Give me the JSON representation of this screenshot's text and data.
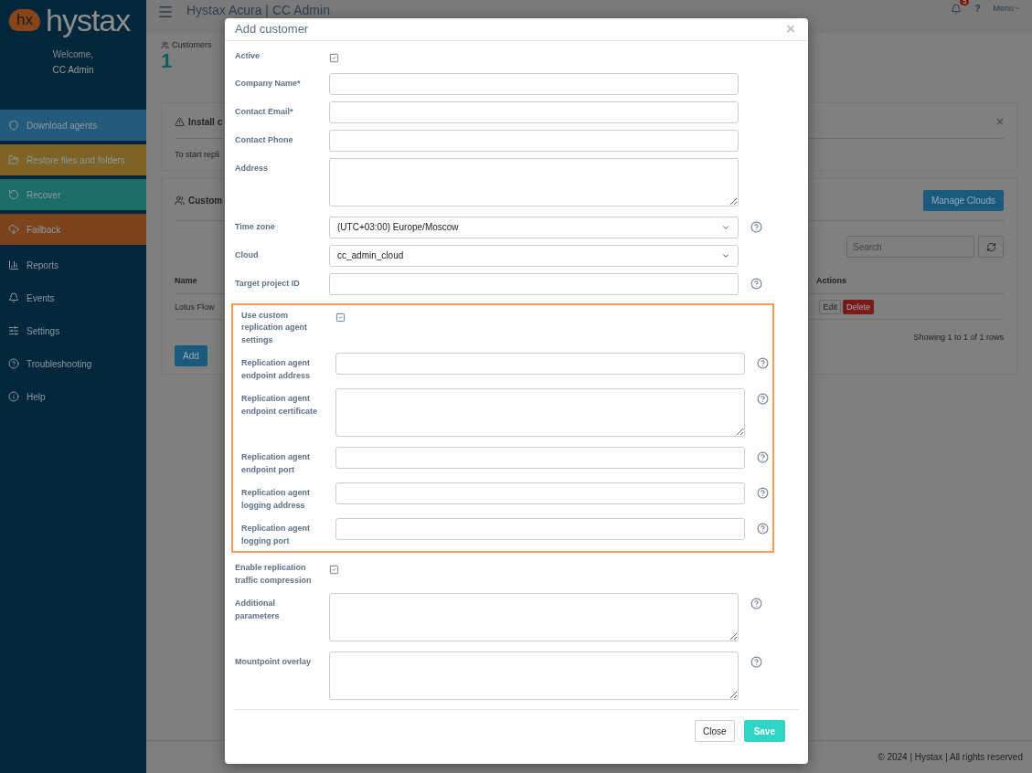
{
  "sidebar": {
    "logo": {
      "mark": "hx",
      "name": "hystax"
    },
    "welcome": "Welcome,",
    "user": "CC Admin",
    "items": [
      {
        "label": "Download agents",
        "color": "#255a7b"
      },
      {
        "label": "Restore files and folders",
        "color": "#7e6226"
      },
      {
        "label": "Recover",
        "color": "#1b6d65"
      },
      {
        "label": "Failback",
        "color": "#7c441d"
      },
      {
        "label": "Reports"
      },
      {
        "label": "Events"
      },
      {
        "label": "Settings"
      },
      {
        "label": "Troubleshooting"
      },
      {
        "label": "Help"
      }
    ]
  },
  "header": {
    "title": "Hystax Acura | CC Admin",
    "notifications": "5",
    "help": "?",
    "menu": "Menu"
  },
  "stats": {
    "label": "Customers",
    "value": "1"
  },
  "install_panel": {
    "title": "Install c",
    "text": "To start repli",
    "close": "×"
  },
  "customers_panel": {
    "title": "Custom",
    "manage_button": "Manage Clouds",
    "search": {
      "placeholder": "Search"
    },
    "columns": [
      "Name",
      "Actions"
    ],
    "rows": [
      {
        "name": "Lotus Flow",
        "actions": [
          "Edit",
          "Delete"
        ]
      }
    ],
    "pagination": "Showing 1 to 1 of 1 rows",
    "add_button": "Add"
  },
  "footer": "© 2024 | Hystax | All rights reserved",
  "modal": {
    "title": "Add customer",
    "close": "×",
    "fields": [
      {
        "kind": "checkbox",
        "label": "Active",
        "checked": true,
        "help": false
      },
      {
        "kind": "input",
        "label": "Company Name*",
        "help": false
      },
      {
        "kind": "input",
        "label": "Contact Email*",
        "help": false
      },
      {
        "kind": "input",
        "label": "Contact Phone",
        "help": false
      },
      {
        "kind": "textarea",
        "label": "Address",
        "help": false
      },
      {
        "kind": "select",
        "label": "Time zone",
        "value": "(UTC+03:00) Europe/Moscow",
        "help": true
      },
      {
        "kind": "select",
        "label": "Cloud",
        "value": "cc_admin_cloud",
        "help": false
      },
      {
        "kind": "input",
        "label": "Target project ID",
        "help": true
      }
    ],
    "highlighted_group": {
      "fields": [
        {
          "kind": "checkbox",
          "label": "Use custom replication agent settings",
          "checked": true,
          "help": false
        },
        {
          "kind": "input",
          "label": "Replication agent endpoint address",
          "help": true
        },
        {
          "kind": "textarea",
          "label": "Replication agent endpoint certificate",
          "help": true
        },
        {
          "kind": "input",
          "label": "Replication agent endpoint port",
          "help": true
        },
        {
          "kind": "input",
          "label": "Replication agent logging address",
          "help": true
        },
        {
          "kind": "input",
          "label": "Replication agent logging port",
          "help": true
        }
      ]
    },
    "fields_after": [
      {
        "kind": "checkbox",
        "label": "Enable replication traffic compression",
        "checked": true,
        "help": false
      },
      {
        "kind": "textarea",
        "label": "Additional parameters",
        "help": true
      },
      {
        "kind": "textarea",
        "label": "Mountpoint overlay",
        "help": true
      }
    ],
    "buttons": [
      "Close",
      "Save"
    ]
  }
}
